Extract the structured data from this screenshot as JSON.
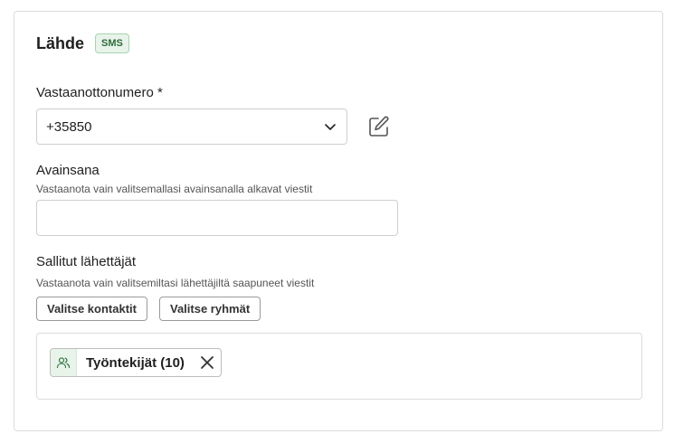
{
  "section": {
    "title": "Lähde",
    "badge": "SMS"
  },
  "receiving_number": {
    "label": "Vastaanottonumero *",
    "value": "+35850"
  },
  "keyword": {
    "label": "Avainsana",
    "help": "Vastaanota vain valitsemallasi avainsanalla alkavat viestit",
    "value": "",
    "placeholder": ""
  },
  "allowed_senders": {
    "label": "Sallitut lähettäjät",
    "help": "Vastaanota vain valitsemiltasi lähettäjiltä saapuneet viestit",
    "select_contacts_label": "Valitse kontaktit",
    "select_groups_label": "Valitse ryhmät",
    "chips": [
      {
        "label": "Työntekijät (10)",
        "icon": "group-icon"
      }
    ]
  },
  "colors": {
    "badge_bg": "#e8f3ea",
    "badge_text": "#2e6b3a"
  }
}
